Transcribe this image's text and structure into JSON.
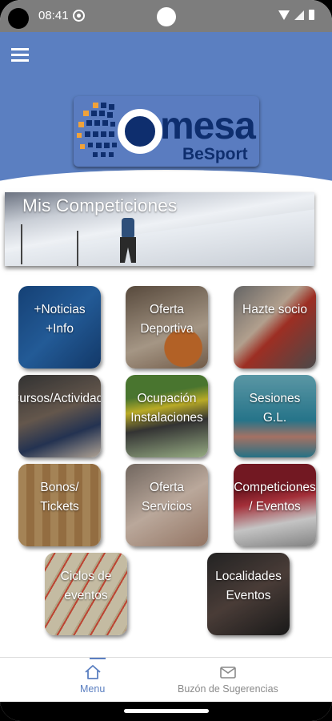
{
  "status_bar": {
    "time": "08:41"
  },
  "header": {
    "logo_word": "mesa",
    "logo_sub": "BeSport",
    "brand_color": "#5b7fc1",
    "logo_text_color": "#0e2e6e"
  },
  "banner": {
    "title": "Mis Competiciones"
  },
  "tiles": [
    {
      "label": "+Noticias\n+Info",
      "icon": "social-network"
    },
    {
      "label": "Oferta\nDeportiva",
      "icon": "sports"
    },
    {
      "label": "Hazte socio",
      "icon": "membership"
    },
    {
      "label": "Cursos/Actividades",
      "icon": "courses"
    },
    {
      "label": "Ocupación\nInstalaciones",
      "icon": "facilities"
    },
    {
      "label": "Sesiones\nG.L.",
      "icon": "pool"
    },
    {
      "label": "Bonos/\nTickets",
      "icon": "tickets"
    },
    {
      "label": "Oferta\nServicios",
      "icon": "services"
    },
    {
      "label": "Competiciones\n/ Eventos",
      "icon": "competitions"
    },
    {
      "label": "Ciclos de\neventos",
      "icon": "cycles"
    },
    {
      "label": "Localidades\nEventos",
      "icon": "seats"
    }
  ],
  "bottom_nav": {
    "menu_label": "Menu",
    "suggestions_label": "Buzón de Sugerencias",
    "active_color": "#5b7fc1",
    "inactive_color": "#8a8a8a"
  }
}
